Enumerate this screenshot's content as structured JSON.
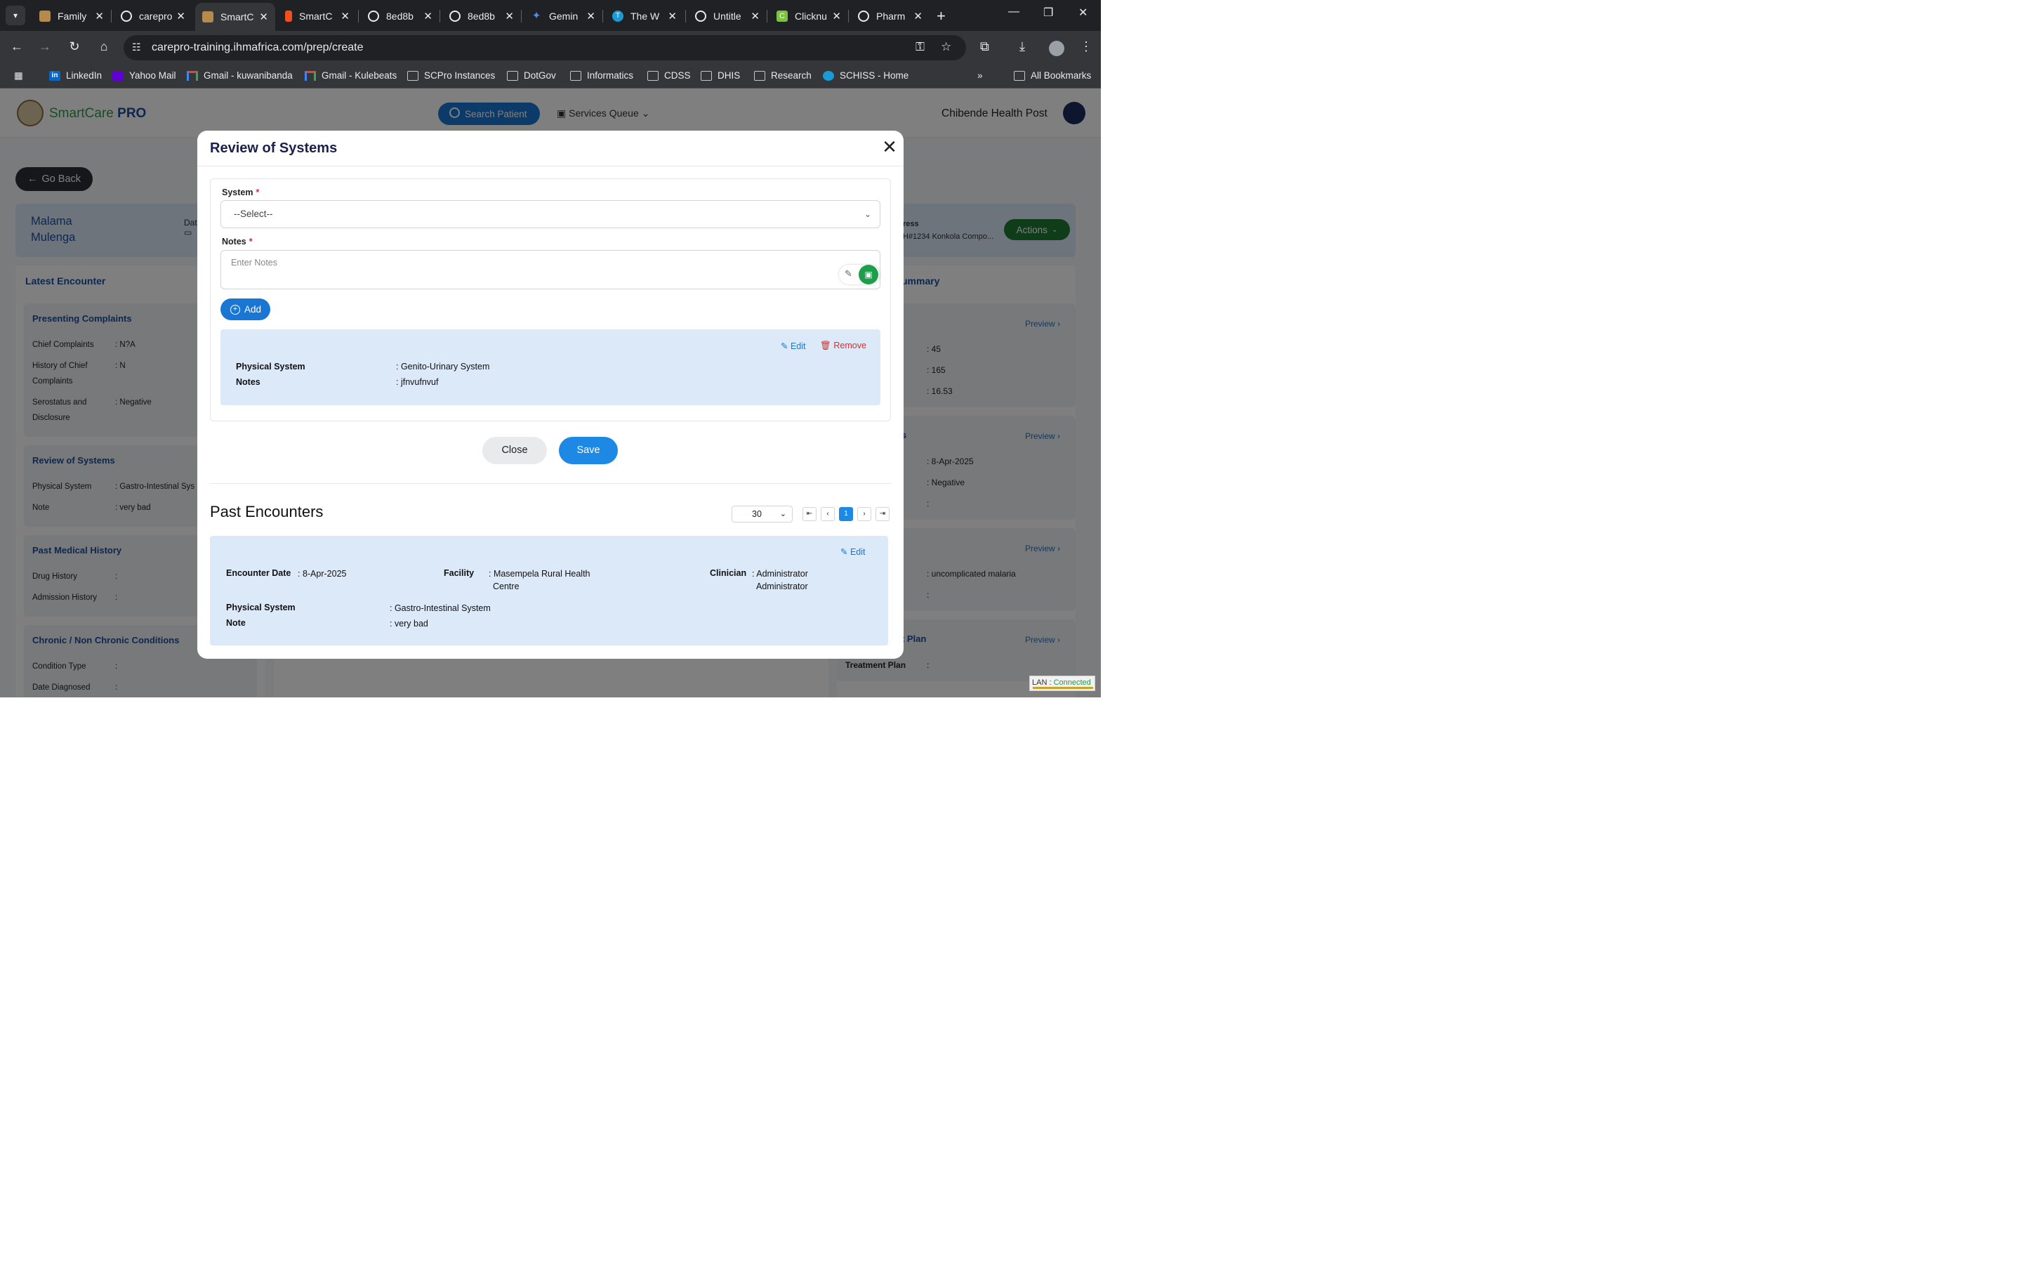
{
  "browser": {
    "tabs": [
      {
        "label": "Family",
        "icon": "app-icon"
      },
      {
        "label": "carepro",
        "icon": "globe-icon"
      },
      {
        "label": "SmartC",
        "icon": "app-icon",
        "active": true
      },
      {
        "label": "SmartC",
        "icon": "figma-icon"
      },
      {
        "label": "8ed8b",
        "icon": "globe-icon"
      },
      {
        "label": "8ed8b",
        "icon": "globe-icon"
      },
      {
        "label": "Gemin",
        "icon": "gemini-icon"
      },
      {
        "label": "The W",
        "icon": "t-icon"
      },
      {
        "label": "Untitle",
        "icon": "globe-icon"
      },
      {
        "label": "Clicknu",
        "icon": "c-icon"
      },
      {
        "label": "Pharm",
        "icon": "refresh-icon"
      }
    ],
    "url": "carepro-training.ihmafrica.com/prep/create",
    "bookmarks": [
      {
        "label": "LinkedIn",
        "icon": "linkedin-icon"
      },
      {
        "label": "Yahoo Mail",
        "icon": "yahoo-icon"
      },
      {
        "label": "Gmail - kuwanibanda",
        "icon": "gmail-icon"
      },
      {
        "label": "Gmail - Kulebeats",
        "icon": "gmail-icon"
      },
      {
        "label": "SCPro Instances",
        "icon": "folder-icon"
      },
      {
        "label": "DotGov",
        "icon": "folder-icon"
      },
      {
        "label": "Informatics",
        "icon": "folder-icon"
      },
      {
        "label": "CDSS",
        "icon": "folder-icon"
      },
      {
        "label": "DHIS",
        "icon": "folder-icon"
      },
      {
        "label": "Research",
        "icon": "folder-icon"
      },
      {
        "label": "SCHISS - Home",
        "icon": "schiss-icon"
      }
    ],
    "all_bookmarks": "All Bookmarks"
  },
  "app": {
    "logo_text_a": "SmartCare",
    "logo_text_b": "PRO",
    "search_patient": "Search Patient",
    "services_queue": "Services Queue",
    "facility": "Chibende Health Post",
    "go_back": "Go Back",
    "patient_first": "Malama",
    "patient_last": "Mulenga",
    "dat_label": "Dat",
    "address_label": "ress",
    "address_value": "H#1234 Konkola Compo...",
    "actions": "Actions"
  },
  "left": {
    "latest_encounter": "Latest Encounter",
    "presenting": {
      "title": "Presenting Complaints",
      "rows": [
        {
          "k": "Chief Complaints",
          "v": ": N?A"
        },
        {
          "k": "History of Chief Complaints",
          "v": ": N"
        },
        {
          "k": "Serostatus and Disclosure",
          "v": ": Negative"
        }
      ]
    },
    "ros": {
      "title": "Review of Systems",
      "rows": [
        {
          "k": "Physical System",
          "v": ": Gastro-Intestinal Sys"
        },
        {
          "k": "Note",
          "v": ": very bad"
        }
      ]
    },
    "pmh": {
      "title": "Past Medical History",
      "rows": [
        {
          "k": "Drug History",
          "v": ":"
        },
        {
          "k": "Admission History",
          "v": ":"
        }
      ]
    },
    "chronic": {
      "title": "Chronic / Non Chronic Conditions",
      "rows": [
        {
          "k": "Condition Type",
          "v": ":"
        },
        {
          "k": "Date Diagnosed",
          "v": ":"
        }
      ]
    }
  },
  "right": {
    "summary": "ummary",
    "preview": "Preview",
    "vitals": [
      ": 45",
      ": 165",
      ": 16.53"
    ],
    "status_head": "us",
    "status_vals": [
      ": 8-Apr-2025",
      ": Negative",
      ":"
    ],
    "diag_head": "is",
    "diag_vals": [
      ": uncomplicated malaria",
      ":"
    ],
    "plan_head": "nt Plan",
    "plan_label": "Treatment Plan",
    "plan_val": ":"
  },
  "modal": {
    "title": "Review of Systems",
    "system_label": "System",
    "system_value": "--Select--",
    "notes_label": "Notes",
    "notes_placeholder": "Enter Notes",
    "add": "Add",
    "entry": {
      "edit": "Edit",
      "remove": "Remove",
      "system_label": "Physical System",
      "system_value": ": Genito-Urinary System",
      "notes_label": "Notes",
      "notes_value": ": jfnvufnvuf"
    },
    "close": "Close",
    "save": "Save",
    "past_title": "Past Encounters",
    "page_size": "30",
    "current_page": "1",
    "past": {
      "edit": "Edit",
      "date_label": "Encounter Date",
      "date_value": ": 8-Apr-2025",
      "facility_label": "Facility",
      "facility_value_1": ": Masempela Rural Health",
      "facility_value_2": "Centre",
      "clinician_label": "Clinician",
      "clinician_value_1": ": Administrator",
      "clinician_value_2": "Administrator",
      "system_label": "Physical System",
      "system_value": ": Gastro-Intestinal System",
      "note_label": "Note",
      "note_value": ": very bad"
    }
  },
  "status": {
    "lan": "LAN :",
    "connected": "Connected"
  }
}
